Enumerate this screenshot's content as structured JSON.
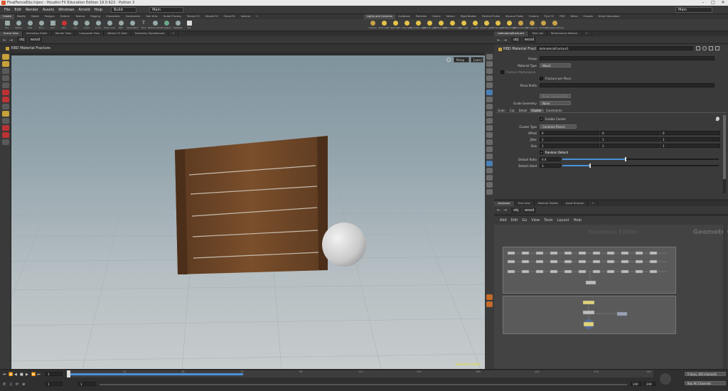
{
  "window": {
    "title": "FinalFenceEdu.hipnc - Houdini FX Education Edition 19.0.622 - Python 3"
  },
  "menubar": {
    "items": [
      "File",
      "Edit",
      "Render",
      "Assets",
      "Windows",
      "Arnold",
      "Help"
    ],
    "build_dropdown": "Build",
    "desktop_dropdown": "Main",
    "right_dropdown": "Main"
  },
  "shelf_left": {
    "tabs": [
      "Create",
      "Modify",
      "Model",
      "Polygon",
      "Deform",
      "Texture",
      "Rigging",
      "Characters",
      "Constraints",
      "Hair Utils",
      "Guide Process",
      "Terrain FX",
      "Simple FX",
      "Cloud FX",
      "Volume"
    ],
    "tools": [
      "Box",
      "Sphere",
      "Tube",
      "Torus",
      "Grid",
      "Null",
      "Line",
      "Circle",
      "Curve",
      "Draw Curve",
      "Path",
      "Spray Paint",
      "Font",
      "Platonic Solids",
      "L-System",
      "Metaball",
      "File"
    ]
  },
  "shelf_right": {
    "tabs": [
      "Lights and Cameras",
      "Collisions",
      "Particles",
      "Grains",
      "Vellum",
      "Rigid Bodies",
      "Particle Fluids",
      "Viscous Fluids",
      "Oceans",
      "Pyro FX",
      "FEM",
      "Wires",
      "Crowds",
      "Drive Simulation"
    ],
    "tools": [
      "Camera",
      "Point Light",
      "Spot Light",
      "Area Light",
      "Geometry Light",
      "Volume Light",
      "Distant Light",
      "Environment Light",
      "Sky Light",
      "GI Light",
      "Caustic Light",
      "Portal Light",
      "Ambient Light",
      "Stereo Camera",
      "VR Camera",
      "Switcher",
      "Gamepad Camera"
    ]
  },
  "left_pane": {
    "tabs": [
      "Scene View",
      "Animation Editor",
      "Render View",
      "Composite View",
      "Motion FX View",
      "Geometry Spreadsheet"
    ],
    "path": [
      "obj",
      "wood"
    ],
    "node_label": "RBD Material Fracture",
    "persp": "Persp",
    "cam": "[cam]",
    "edu_watermark": "Education Edition"
  },
  "param_pane": {
    "tabs": [
      "rbdmaterialfracture1",
      "Take List",
      "Performance Monitor"
    ],
    "path": [
      "obj",
      "wood"
    ],
    "node_type": "RBD Material Fracture",
    "node_name": "rbdmaterialfracture1",
    "group_label": "Group",
    "group_value": "",
    "material_type_label": "Material Type",
    "material_type_value": "Wood",
    "fracture_namespace_label": "Fracture Namespace",
    "fracture_per_piece_label": "Fracture per Piece",
    "piece_prefix_label": "Piece Prefix",
    "piece_prefix_value": "",
    "reset_cached_pins": "Reset Cached Pins",
    "guide_geometry_label": "Guide Geometry",
    "guide_geometry_value": "None",
    "subtabs": [
      "Grain",
      "Cut",
      "Detail",
      "Cluster",
      "Constraints"
    ],
    "enable_cluster_label": "Enable Cluster",
    "cluster_type_label": "Cluster Type",
    "cluster_type_value": "Combine Pieces",
    "offset_label": "Offset",
    "offset": [
      "0",
      "0",
      "0"
    ],
    "jitter_label": "Jitter",
    "jitter": [
      "1",
      "1",
      "1"
    ],
    "size_label": "Size",
    "size": [
      "1",
      "1",
      "1"
    ],
    "random_detach_label": "Random Detach",
    "detach_ratio_label": "Detach Ratio",
    "detach_ratio_value": "0.4",
    "detach_ratio_fraction": 0.4,
    "detach_seed_label": "Detach Seed",
    "detach_seed_value": "3"
  },
  "network_pane": {
    "tabs": [
      "/obj/wood",
      "Tree View",
      "Material Palette",
      "Asset Browser"
    ],
    "path": [
      "obj",
      "wood"
    ],
    "menu": [
      "Add",
      "Edit",
      "Go",
      "View",
      "Tools",
      "Layout",
      "Help"
    ],
    "watermark": "Education Edition",
    "context_label": "Geometry"
  },
  "timeline": {
    "frame": "1",
    "start": "1",
    "start2": "1",
    "end": "240",
    "end2": "240",
    "keys_label": "0 keys, 0/0 channels",
    "key_all_label": "Key All Channels",
    "ticks": [
      "1",
      "24",
      "48",
      "72",
      "96",
      "120",
      "144",
      "168",
      "192",
      "216",
      "240"
    ]
  },
  "colors": {
    "accent_blue": "#4a90d9",
    "wood": "#6b4424",
    "sky_top": "#7f939d"
  }
}
